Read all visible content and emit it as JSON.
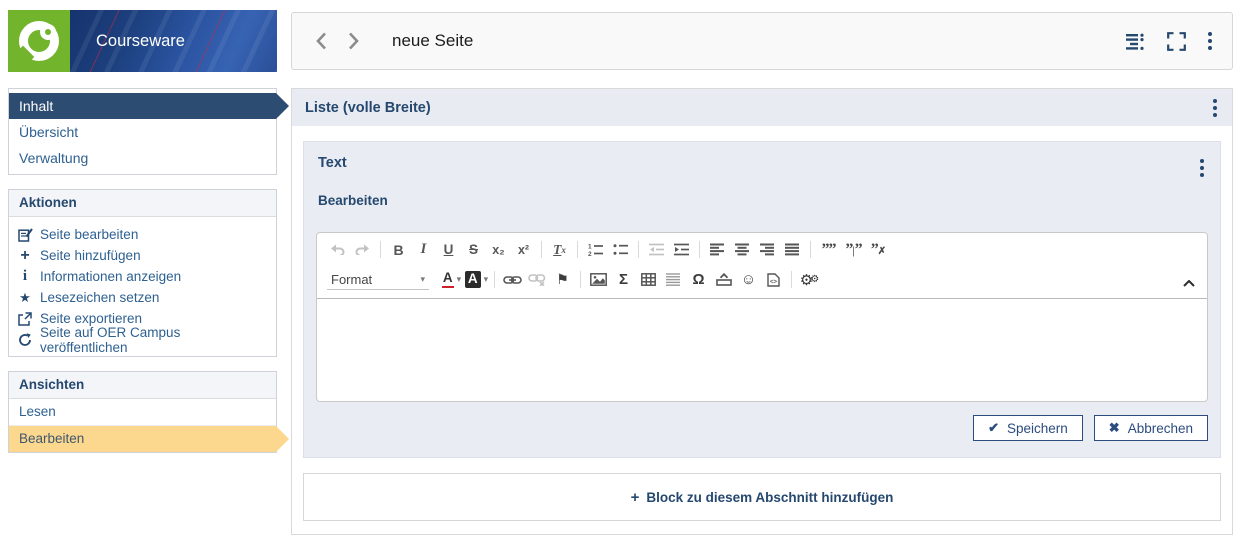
{
  "app": {
    "name": "Courseware"
  },
  "colors": {
    "navy": "#25486f",
    "link_blue": "#2e6091",
    "active_nav_bg": "#2d4c71",
    "active_view_bg": "#fbd88e",
    "panel_header_bg": "#e8ecf2",
    "logo_green": "#72b42c",
    "banner_blue": "#2a53a0",
    "button_border": "#2b4c7e"
  },
  "sidebar": {
    "nav": {
      "items": [
        {
          "label": "Inhalt",
          "active": true
        },
        {
          "label": "Übersicht",
          "active": false
        },
        {
          "label": "Verwaltung",
          "active": false
        }
      ]
    },
    "actions": {
      "title": "Aktionen",
      "items": [
        {
          "icon": "edit-page-icon",
          "label": "Seite bearbeiten"
        },
        {
          "icon": "plus-icon",
          "label": "Seite hinzufügen"
        },
        {
          "icon": "info-icon",
          "label": "Informationen anzeigen"
        },
        {
          "icon": "star-icon",
          "label": "Lesezeichen setzen"
        },
        {
          "icon": "export-icon",
          "label": "Seite exportieren"
        },
        {
          "icon": "publish-icon",
          "label": "Seite auf OER Campus veröffentlichen"
        }
      ]
    },
    "views": {
      "title": "Ansichten",
      "items": [
        {
          "label": "Lesen",
          "active": false
        },
        {
          "label": "Bearbeiten",
          "active": true
        }
      ]
    }
  },
  "header": {
    "title": "neue Seite",
    "icons": [
      "back-chevron-icon",
      "forward-chevron-icon",
      "outline-icon",
      "fullscreen-icon",
      "kebab-menu-icon"
    ]
  },
  "content": {
    "section_title": "Liste (volle Breite)",
    "block": {
      "title": "Text",
      "tab_label": "Bearbeiten",
      "editor": {
        "format_label": "Format",
        "content": "",
        "toolbar_row1": [
          {
            "n": "undo",
            "disabled": true
          },
          {
            "n": "redo",
            "disabled": true
          },
          {
            "n": "sep"
          },
          {
            "n": "bold"
          },
          {
            "n": "italic"
          },
          {
            "n": "underline"
          },
          {
            "n": "strikethrough"
          },
          {
            "n": "subscript"
          },
          {
            "n": "superscript"
          },
          {
            "n": "sep"
          },
          {
            "n": "remove-format"
          },
          {
            "n": "sep"
          },
          {
            "n": "numbered-list"
          },
          {
            "n": "bulleted-list"
          },
          {
            "n": "sep"
          },
          {
            "n": "outdent",
            "disabled": true
          },
          {
            "n": "indent"
          },
          {
            "n": "sep"
          },
          {
            "n": "align-left"
          },
          {
            "n": "align-center"
          },
          {
            "n": "align-right"
          },
          {
            "n": "align-justify"
          },
          {
            "n": "sep"
          },
          {
            "n": "blockquote"
          },
          {
            "n": "quote-inline"
          },
          {
            "n": "quote-remove"
          }
        ],
        "toolbar_row2": [
          {
            "n": "format-dropdown"
          },
          {
            "n": "text-color"
          },
          {
            "n": "bg-color"
          },
          {
            "n": "sep"
          },
          {
            "n": "link"
          },
          {
            "n": "unlink",
            "disabled": true
          },
          {
            "n": "anchor-flag"
          },
          {
            "n": "sep"
          },
          {
            "n": "image"
          },
          {
            "n": "math-sigma"
          },
          {
            "n": "table"
          },
          {
            "n": "hr-lines"
          },
          {
            "n": "special-char-omega"
          },
          {
            "n": "placeholder-box"
          },
          {
            "n": "smiley"
          },
          {
            "n": "source-doc"
          },
          {
            "n": "sep"
          },
          {
            "n": "gears"
          }
        ]
      },
      "save_label": "Speichern",
      "cancel_label": "Abbrechen"
    },
    "add_block_label": "Block zu diesem Abschnitt hinzufügen"
  }
}
